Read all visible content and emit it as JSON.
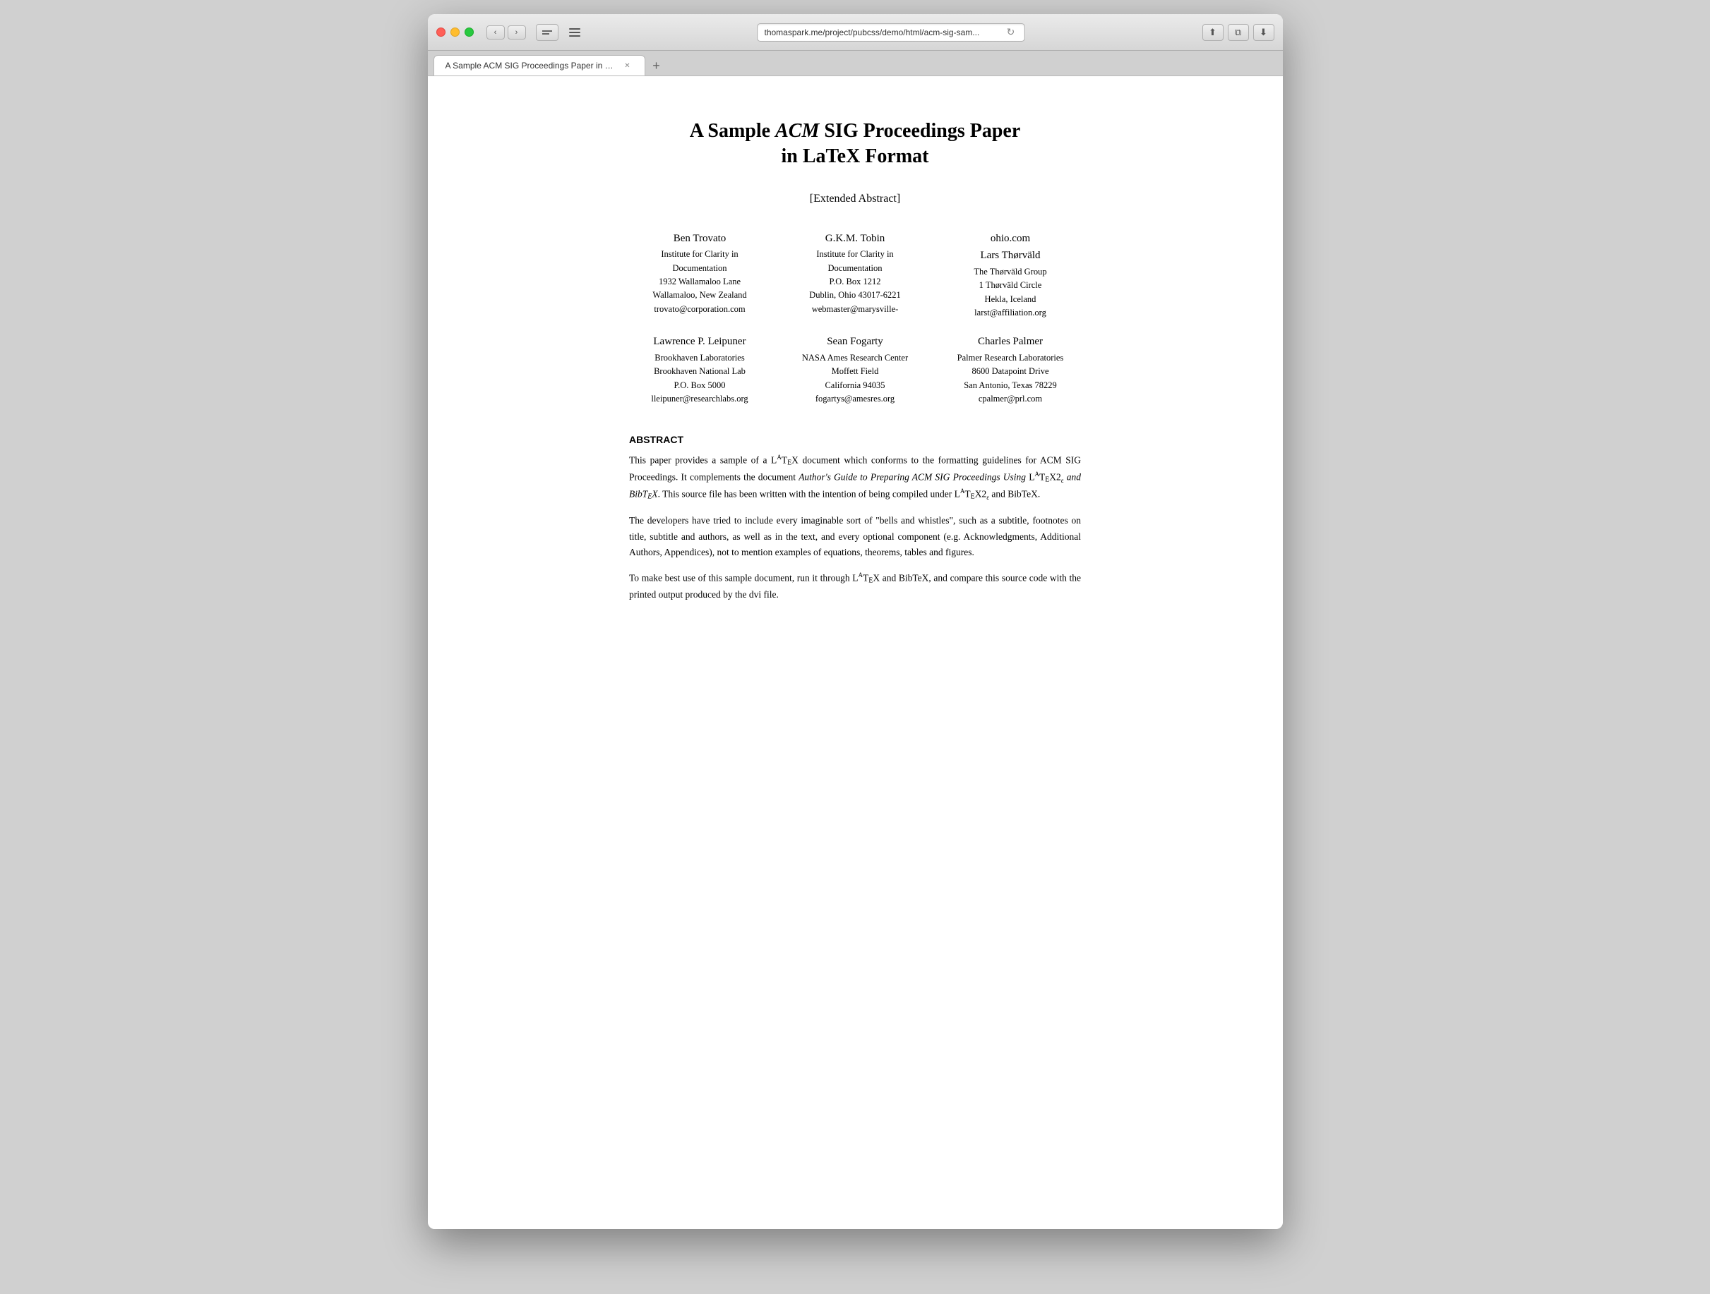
{
  "window": {
    "title": "A Sample ACM SIG Proceedings Paper in LaTeX Format",
    "url": "thomaspark.me/project/pubcss/demo/html/acm-sig-sam..."
  },
  "toolbar": {
    "back_label": "‹",
    "forward_label": "›",
    "reload_label": "↻",
    "share_label": "⬆",
    "duplicate_label": "⧉",
    "download_label": "⬇"
  },
  "tab": {
    "label": "A Sample ACM SIG Proceedings Paper in LaTeX Format",
    "add_label": "+"
  },
  "paper": {
    "title_part1": "A Sample ",
    "title_acm": "ACM",
    "title_part2": " SIG Proceedings Paper",
    "title_line2": "in LaTeX Format",
    "extended_abstract": "[Extended Abstract]",
    "authors": [
      {
        "name": "Ben Trovato",
        "affiliation": "Institute for Clarity in Documentation\n1932 Wallamaloo Lane\nWallamaloo, New Zealand",
        "email": "trovato@corporation.com"
      },
      {
        "name": "G.K.M. Tobin",
        "affiliation": "Institute for Clarity in Documentation\nP.O. Box 1212\nDublin, Ohio 43017-6221",
        "email": "webmaster@marysville-"
      },
      {
        "name": "ohio.com\nLars Thørväld",
        "affiliation": "The Thørväld Group\n1 Thørväld Circle\nHekla, Iceland",
        "email": "larst@affiliation.org"
      },
      {
        "name": "Lawrence P. Leipuner",
        "affiliation": "Brookhaven Laboratories\nBrookhaven National Lab\nP.O. Box 5000",
        "email": "lleipuner@researchlabs.org"
      },
      {
        "name": "Sean Fogarty",
        "affiliation": "NASA Ames Research Center\nMoffett Field\nCalifornia 94035",
        "email": "fogartys@amesres.org"
      },
      {
        "name": "Charles Palmer",
        "affiliation": "Palmer Research Laboratories\n8600 Datapoint Drive\nSan Antonio, Texas 78229",
        "email": "cpalmer@prl.com"
      }
    ],
    "abstract_title": "ABSTRACT",
    "abstract_paragraphs": [
      "This paper provides a sample of a LaTeX document which conforms to the formatting guidelines for ACM SIG Proceedings. It complements the document Author's Guide to Preparing ACM SIG Proceedings Using LaTeX2ε and BibTeX. This source file has been written with the intention of being compiled under LaTeX2ε and BibTeX.",
      "The developers have tried to include every imaginable sort of \"bells and whistles\", such as a subtitle, footnotes on title, subtitle and authors, as well as in the text, and every optional component (e.g. Acknowledgments, Additional Authors, Appendices), not to mention examples of equations, theorems, tables and figures.",
      "To make best use of this sample document, run it through LaTeX and BibTeX, and compare this source code with the printed output produced by the dvi file."
    ]
  }
}
